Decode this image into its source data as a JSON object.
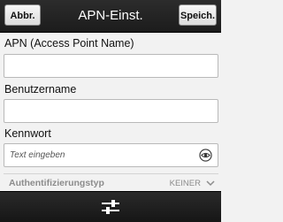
{
  "header": {
    "cancel_label": "Abbr.",
    "title": "APN-Einst.",
    "save_label": "Speich."
  },
  "fields": {
    "apn_label": "APN (Access Point Name)",
    "apn_value": "",
    "username_label": "Benutzername",
    "username_value": "",
    "password_label": "Kennwort",
    "password_placeholder": "Text eingeben",
    "password_icon": "eye-icon"
  },
  "auth": {
    "label": "Authentifizierungstyp",
    "value": "KEINER",
    "icon": "chevron-down-icon"
  },
  "bottombar": {
    "icon": "settings-sliders-icon"
  },
  "colors": {
    "bar": "#1e1e1e",
    "background": "#f2f2f2",
    "muted_text": "#8c8c8c"
  }
}
